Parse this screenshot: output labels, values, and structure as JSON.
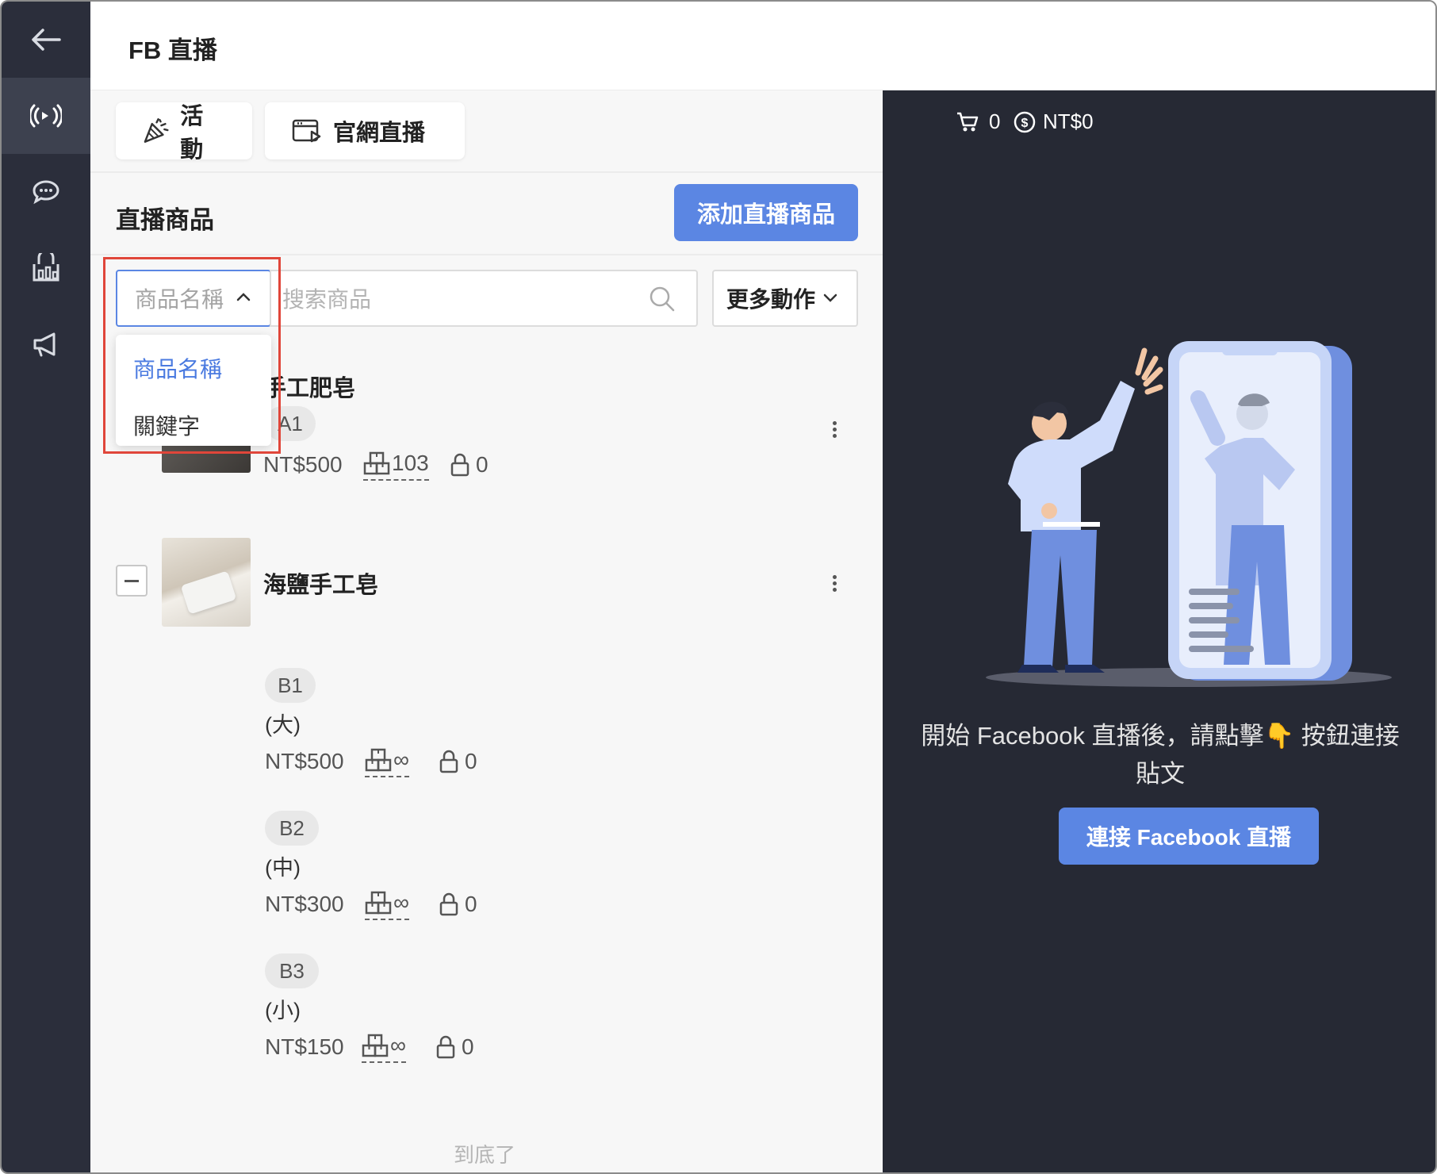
{
  "header": {
    "title": "FB 直播"
  },
  "sidebar": {
    "items": [
      {
        "icon": "back-arrow-icon"
      },
      {
        "icon": "live-broadcast-icon",
        "active": true
      },
      {
        "icon": "chat-bubble-icon"
      },
      {
        "icon": "store-icon"
      },
      {
        "icon": "megaphone-icon"
      }
    ]
  },
  "tabs": [
    {
      "label": "活動",
      "icon": "party-popper-icon"
    },
    {
      "label": "官網直播",
      "icon": "browser-play-icon"
    }
  ],
  "section": {
    "title": "直播商品",
    "add_button": "添加直播商品"
  },
  "filter": {
    "select_value": "商品名稱",
    "search_placeholder": "搜索商品",
    "more_actions": "更多動作",
    "options": [
      "商品名稱",
      "關鍵字"
    ]
  },
  "products": [
    {
      "name": "手工肥皂",
      "variants": [
        {
          "sku": "A1",
          "label": "",
          "price": "NT$500",
          "stock": "103",
          "reserved": "0"
        }
      ]
    },
    {
      "name": "海鹽手工皂",
      "variants": [
        {
          "sku": "B1",
          "label": "(大)",
          "price": "NT$500",
          "stock": "∞",
          "reserved": "0"
        },
        {
          "sku": "B2",
          "label": "(中)",
          "price": "NT$300",
          "stock": "∞",
          "reserved": "0"
        },
        {
          "sku": "B3",
          "label": "(小)",
          "price": "NT$150",
          "stock": "∞",
          "reserved": "0"
        }
      ]
    }
  ],
  "list_end": "到底了",
  "right_panel": {
    "cart_count": "0",
    "total": "NT$0",
    "message": "開始 Facebook 直播後，請點擊👇 按鈕連接貼文",
    "connect_button": "連接 Facebook 直播"
  },
  "colors": {
    "accent": "#5b86e3",
    "sidebar_bg": "#2b2e3b",
    "dark_panel": "#262934",
    "highlight": "#e0463a"
  }
}
